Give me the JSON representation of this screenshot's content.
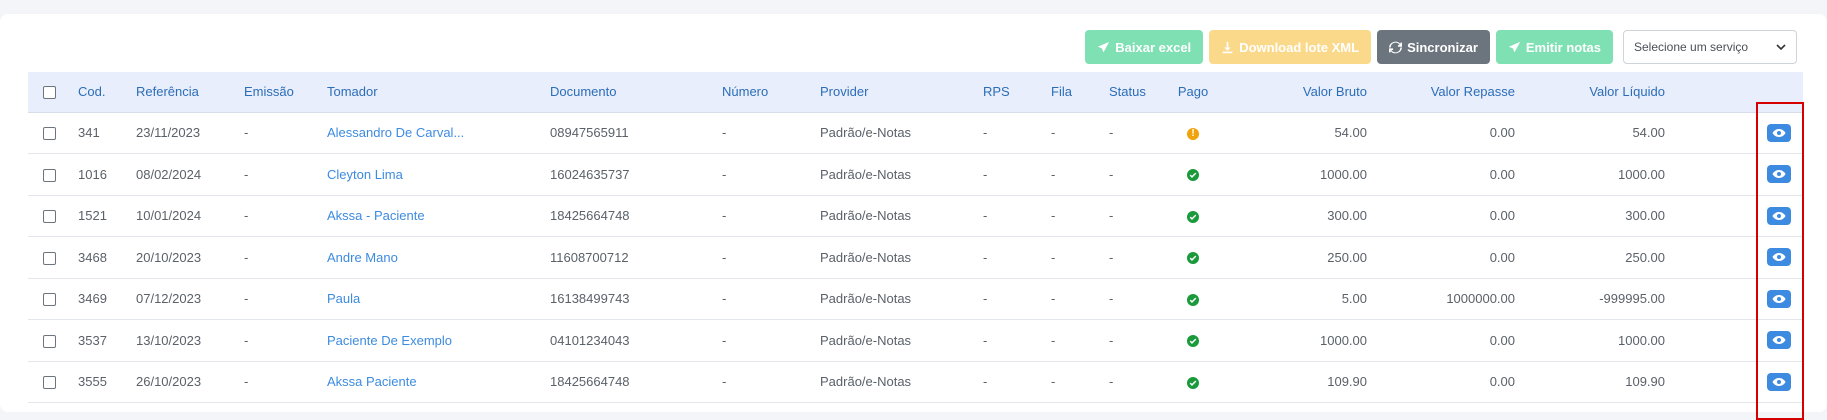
{
  "toolbar": {
    "baixar_excel": "Baixar excel",
    "download_xml": "Download lote XML",
    "sincronizar": "Sincronizar",
    "emitir_notas": "Emitir notas",
    "service_select": "Selecione um serviço"
  },
  "columns": [
    "Cod.",
    "Referência",
    "Emissão",
    "Tomador",
    "Documento",
    "Número",
    "Provider",
    "RPS",
    "Fila",
    "Status",
    "Pago",
    "Valor Bruto",
    "Valor Repasse",
    "Valor Líquido"
  ],
  "rows": [
    {
      "cod": "341",
      "ref": "23/11/2023",
      "emissao": "-",
      "tomador": "Alessandro De Carval...",
      "documento": "08947565911",
      "numero": "-",
      "provider": "Padrão/e-Notas",
      "rps": "-",
      "fila": "-",
      "status": "-",
      "pago": "warning",
      "bruto": "54.00",
      "repasse": "0.00",
      "liquido": "54.00"
    },
    {
      "cod": "1016",
      "ref": "08/02/2024",
      "emissao": "-",
      "tomador": "Cleyton Lima",
      "documento": "16024635737",
      "numero": "-",
      "provider": "Padrão/e-Notas",
      "rps": "-",
      "fila": "-",
      "status": "-",
      "pago": "ok",
      "bruto": "1000.00",
      "repasse": "0.00",
      "liquido": "1000.00"
    },
    {
      "cod": "1521",
      "ref": "10/01/2024",
      "emissao": "-",
      "tomador": "Akssa - Paciente",
      "documento": "18425664748",
      "numero": "-",
      "provider": "Padrão/e-Notas",
      "rps": "-",
      "fila": "-",
      "status": "-",
      "pago": "ok",
      "bruto": "300.00",
      "repasse": "0.00",
      "liquido": "300.00"
    },
    {
      "cod": "3468",
      "ref": "20/10/2023",
      "emissao": "-",
      "tomador": "Andre Mano",
      "documento": "11608700712",
      "numero": "-",
      "provider": "Padrão/e-Notas",
      "rps": "-",
      "fila": "-",
      "status": "-",
      "pago": "ok",
      "bruto": "250.00",
      "repasse": "0.00",
      "liquido": "250.00"
    },
    {
      "cod": "3469",
      "ref": "07/12/2023",
      "emissao": "-",
      "tomador": "Paula",
      "documento": "16138499743",
      "numero": "-",
      "provider": "Padrão/e-Notas",
      "rps": "-",
      "fila": "-",
      "status": "-",
      "pago": "ok",
      "bruto": "5.00",
      "repasse": "1000000.00",
      "liquido": "-999995.00"
    },
    {
      "cod": "3537",
      "ref": "13/10/2023",
      "emissao": "-",
      "tomador": "Paciente De Exemplo",
      "documento": "04101234043",
      "numero": "-",
      "provider": "Padrão/e-Notas",
      "rps": "-",
      "fila": "-",
      "status": "-",
      "pago": "ok",
      "bruto": "1000.00",
      "repasse": "0.00",
      "liquido": "1000.00"
    },
    {
      "cod": "3555",
      "ref": "26/10/2023",
      "emissao": "-",
      "tomador": "Akssa Paciente",
      "documento": "18425664748",
      "numero": "-",
      "provider": "Padrão/e-Notas",
      "rps": "-",
      "fila": "-",
      "status": "-",
      "pago": "ok",
      "bruto": "109.90",
      "repasse": "0.00",
      "liquido": "109.90"
    }
  ],
  "colors": {
    "accent": "#3d8be0",
    "header_bg": "#e8eefb",
    "paid": "#1a9a3a",
    "pending": "#f0a30a",
    "highlight": "#d60000"
  }
}
